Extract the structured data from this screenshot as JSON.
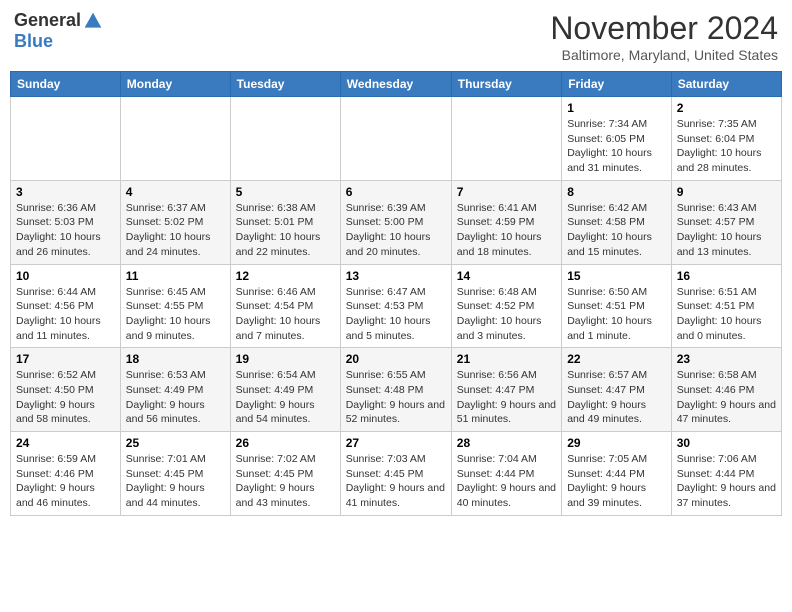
{
  "logo": {
    "general": "General",
    "blue": "Blue"
  },
  "title": "November 2024",
  "location": "Baltimore, Maryland, United States",
  "days_of_week": [
    "Sunday",
    "Monday",
    "Tuesday",
    "Wednesday",
    "Thursday",
    "Friday",
    "Saturday"
  ],
  "weeks": [
    [
      {
        "day": "",
        "info": ""
      },
      {
        "day": "",
        "info": ""
      },
      {
        "day": "",
        "info": ""
      },
      {
        "day": "",
        "info": ""
      },
      {
        "day": "",
        "info": ""
      },
      {
        "day": "1",
        "info": "Sunrise: 7:34 AM\nSunset: 6:05 PM\nDaylight: 10 hours and 31 minutes."
      },
      {
        "day": "2",
        "info": "Sunrise: 7:35 AM\nSunset: 6:04 PM\nDaylight: 10 hours and 28 minutes."
      }
    ],
    [
      {
        "day": "3",
        "info": "Sunrise: 6:36 AM\nSunset: 5:03 PM\nDaylight: 10 hours and 26 minutes."
      },
      {
        "day": "4",
        "info": "Sunrise: 6:37 AM\nSunset: 5:02 PM\nDaylight: 10 hours and 24 minutes."
      },
      {
        "day": "5",
        "info": "Sunrise: 6:38 AM\nSunset: 5:01 PM\nDaylight: 10 hours and 22 minutes."
      },
      {
        "day": "6",
        "info": "Sunrise: 6:39 AM\nSunset: 5:00 PM\nDaylight: 10 hours and 20 minutes."
      },
      {
        "day": "7",
        "info": "Sunrise: 6:41 AM\nSunset: 4:59 PM\nDaylight: 10 hours and 18 minutes."
      },
      {
        "day": "8",
        "info": "Sunrise: 6:42 AM\nSunset: 4:58 PM\nDaylight: 10 hours and 15 minutes."
      },
      {
        "day": "9",
        "info": "Sunrise: 6:43 AM\nSunset: 4:57 PM\nDaylight: 10 hours and 13 minutes."
      }
    ],
    [
      {
        "day": "10",
        "info": "Sunrise: 6:44 AM\nSunset: 4:56 PM\nDaylight: 10 hours and 11 minutes."
      },
      {
        "day": "11",
        "info": "Sunrise: 6:45 AM\nSunset: 4:55 PM\nDaylight: 10 hours and 9 minutes."
      },
      {
        "day": "12",
        "info": "Sunrise: 6:46 AM\nSunset: 4:54 PM\nDaylight: 10 hours and 7 minutes."
      },
      {
        "day": "13",
        "info": "Sunrise: 6:47 AM\nSunset: 4:53 PM\nDaylight: 10 hours and 5 minutes."
      },
      {
        "day": "14",
        "info": "Sunrise: 6:48 AM\nSunset: 4:52 PM\nDaylight: 10 hours and 3 minutes."
      },
      {
        "day": "15",
        "info": "Sunrise: 6:50 AM\nSunset: 4:51 PM\nDaylight: 10 hours and 1 minute."
      },
      {
        "day": "16",
        "info": "Sunrise: 6:51 AM\nSunset: 4:51 PM\nDaylight: 10 hours and 0 minutes."
      }
    ],
    [
      {
        "day": "17",
        "info": "Sunrise: 6:52 AM\nSunset: 4:50 PM\nDaylight: 9 hours and 58 minutes."
      },
      {
        "day": "18",
        "info": "Sunrise: 6:53 AM\nSunset: 4:49 PM\nDaylight: 9 hours and 56 minutes."
      },
      {
        "day": "19",
        "info": "Sunrise: 6:54 AM\nSunset: 4:49 PM\nDaylight: 9 hours and 54 minutes."
      },
      {
        "day": "20",
        "info": "Sunrise: 6:55 AM\nSunset: 4:48 PM\nDaylight: 9 hours and 52 minutes."
      },
      {
        "day": "21",
        "info": "Sunrise: 6:56 AM\nSunset: 4:47 PM\nDaylight: 9 hours and 51 minutes."
      },
      {
        "day": "22",
        "info": "Sunrise: 6:57 AM\nSunset: 4:47 PM\nDaylight: 9 hours and 49 minutes."
      },
      {
        "day": "23",
        "info": "Sunrise: 6:58 AM\nSunset: 4:46 PM\nDaylight: 9 hours and 47 minutes."
      }
    ],
    [
      {
        "day": "24",
        "info": "Sunrise: 6:59 AM\nSunset: 4:46 PM\nDaylight: 9 hours and 46 minutes."
      },
      {
        "day": "25",
        "info": "Sunrise: 7:01 AM\nSunset: 4:45 PM\nDaylight: 9 hours and 44 minutes."
      },
      {
        "day": "26",
        "info": "Sunrise: 7:02 AM\nSunset: 4:45 PM\nDaylight: 9 hours and 43 minutes."
      },
      {
        "day": "27",
        "info": "Sunrise: 7:03 AM\nSunset: 4:45 PM\nDaylight: 9 hours and 41 minutes."
      },
      {
        "day": "28",
        "info": "Sunrise: 7:04 AM\nSunset: 4:44 PM\nDaylight: 9 hours and 40 minutes."
      },
      {
        "day": "29",
        "info": "Sunrise: 7:05 AM\nSunset: 4:44 PM\nDaylight: 9 hours and 39 minutes."
      },
      {
        "day": "30",
        "info": "Sunrise: 7:06 AM\nSunset: 4:44 PM\nDaylight: 9 hours and 37 minutes."
      }
    ]
  ]
}
